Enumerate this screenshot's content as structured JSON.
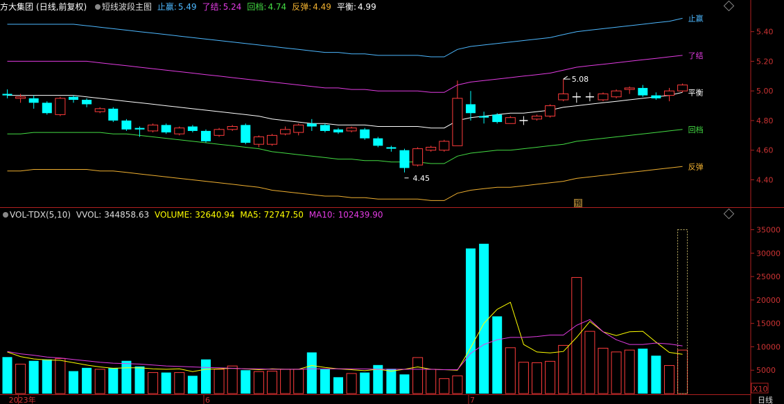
{
  "header": {
    "stock": "方大集团",
    "period": "(日线,前复权)",
    "indicator_icon": "circle-dot-icon",
    "indicator_name": "短线波段主图",
    "items": [
      {
        "label": "止赢:",
        "value": "5.49",
        "color": "#4db8ff"
      },
      {
        "label": "了结:",
        "value": "5.24",
        "color": "#e33ce3"
      },
      {
        "label": "回档:",
        "value": "4.74",
        "color": "#44dd44"
      },
      {
        "label": "反弹:",
        "value": "4.49",
        "color": "#f0b030"
      },
      {
        "label": "平衡:",
        "value": "4.99",
        "color": "#ffffff"
      }
    ]
  },
  "vol_header": {
    "name": "VOL-TDX(5,10)",
    "vvol_label": "VVOL:",
    "vvol": "344858.63",
    "volume_label": "VOLUME:",
    "volume": "32640.94",
    "ma5_label": "MA5:",
    "ma5": "72747.50",
    "ma10_label": "MA10:",
    "ma10": "102439.90"
  },
  "colors": {
    "up": "#ff3c3c",
    "down": "#00ffff",
    "zhiying": "#4db8ff",
    "liaojie": "#e33ce3",
    "huidang": "#44dd44",
    "fantan": "#f0b030",
    "pingheng": "#ffffff",
    "ma5": "#ffff00",
    "ma10": "#e33ce3",
    "axis": "#b02020",
    "ytick": "#cc3333"
  },
  "chart_data": [
    {
      "type": "candlestick",
      "y_ticks": [
        "5.40",
        "5.20",
        "5.00",
        "4.80",
        "4.60",
        "4.40"
      ],
      "ylim": [
        4.22,
        5.52
      ],
      "line_labels": {
        "zhiying": "止赢",
        "liaojie": "了结",
        "pingheng": "平衡",
        "huidang": "回档",
        "fantan": "反弹"
      },
      "annotations": {
        "high": "5.08",
        "low": "4.45",
        "marker": "预"
      },
      "candles": [
        [
          4.98,
          4.97,
          5.01,
          4.95
        ],
        [
          4.95,
          4.96,
          4.98,
          4.92
        ],
        [
          4.95,
          4.92,
          4.97,
          4.88
        ],
        [
          4.92,
          4.85,
          4.93,
          4.84
        ],
        [
          4.84,
          4.95,
          4.96,
          4.83
        ],
        [
          4.96,
          4.94,
          4.97,
          4.92
        ],
        [
          4.94,
          4.91,
          4.95,
          4.89
        ],
        [
          4.86,
          4.88,
          4.89,
          4.85
        ],
        [
          4.88,
          4.8,
          4.89,
          4.79
        ],
        [
          4.8,
          4.74,
          4.81,
          4.73
        ],
        [
          4.75,
          4.74,
          4.76,
          4.69
        ],
        [
          4.73,
          4.77,
          4.78,
          4.72
        ],
        [
          4.77,
          4.72,
          4.78,
          4.71
        ],
        [
          4.71,
          4.75,
          4.76,
          4.7
        ],
        [
          4.76,
          4.73,
          4.77,
          4.72
        ],
        [
          4.73,
          4.66,
          4.74,
          4.65
        ],
        [
          4.7,
          4.74,
          4.75,
          4.69
        ],
        [
          4.74,
          4.76,
          4.77,
          4.73
        ],
        [
          4.77,
          4.65,
          4.78,
          4.64
        ],
        [
          4.64,
          4.69,
          4.7,
          4.62
        ],
        [
          4.64,
          4.7,
          4.71,
          4.63
        ],
        [
          4.71,
          4.74,
          4.76,
          4.7
        ],
        [
          4.72,
          4.77,
          4.78,
          4.7
        ],
        [
          4.78,
          4.76,
          4.81,
          4.73
        ],
        [
          4.77,
          4.73,
          4.78,
          4.72
        ],
        [
          4.74,
          4.72,
          4.75,
          4.71
        ],
        [
          4.73,
          4.75,
          4.76,
          4.72
        ],
        [
          4.74,
          4.68,
          4.75,
          4.67
        ],
        [
          4.68,
          4.63,
          4.69,
          4.62
        ],
        [
          4.62,
          4.61,
          4.63,
          4.59
        ],
        [
          4.6,
          4.48,
          4.61,
          4.45
        ],
        [
          4.5,
          4.61,
          4.62,
          4.49
        ],
        [
          4.6,
          4.62,
          4.63,
          4.59
        ],
        [
          4.6,
          4.66,
          4.67,
          4.59
        ],
        [
          4.63,
          4.95,
          5.07,
          4.63
        ],
        [
          4.91,
          4.85,
          5.0,
          4.8
        ],
        [
          4.83,
          4.82,
          4.86,
          4.78
        ],
        [
          4.84,
          4.79,
          4.85,
          4.78
        ],
        [
          4.78,
          4.82,
          4.83,
          4.78
        ],
        [
          4.8,
          4.8,
          4.83,
          4.77
        ],
        [
          4.81,
          4.83,
          4.84,
          4.8
        ],
        [
          4.83,
          4.9,
          4.91,
          4.82
        ],
        [
          4.94,
          4.98,
          5.08,
          4.93
        ],
        [
          4.96,
          4.96,
          4.99,
          4.92
        ],
        [
          4.96,
          4.96,
          4.99,
          4.93
        ],
        [
          4.94,
          4.98,
          4.99,
          4.93
        ],
        [
          4.96,
          5.0,
          5.01,
          4.95
        ],
        [
          5.01,
          5.02,
          5.03,
          4.98
        ],
        [
          5.02,
          4.97,
          5.04,
          4.96
        ],
        [
          4.97,
          4.95,
          4.99,
          4.94
        ],
        [
          4.97,
          5.0,
          5.02,
          4.93
        ],
        [
          5.0,
          5.04,
          5.05,
          4.99
        ]
      ],
      "pingheng": [
        4.97,
        4.97,
        4.97,
        4.97,
        4.97,
        4.97,
        4.96,
        4.95,
        4.94,
        4.93,
        4.92,
        4.91,
        4.9,
        4.89,
        4.88,
        4.87,
        4.86,
        4.85,
        4.84,
        4.83,
        4.81,
        4.8,
        4.79,
        4.78,
        4.78,
        4.77,
        4.77,
        4.77,
        4.76,
        4.76,
        4.76,
        4.76,
        4.75,
        4.75,
        4.8,
        4.82,
        4.83,
        4.84,
        4.85,
        4.85,
        4.86,
        4.87,
        4.89,
        4.9,
        4.91,
        4.92,
        4.93,
        4.94,
        4.95,
        4.96,
        4.97,
        4.99
      ],
      "zhiying": [
        5.45,
        5.45,
        5.45,
        5.45,
        5.45,
        5.45,
        5.44,
        5.43,
        5.42,
        5.41,
        5.4,
        5.39,
        5.38,
        5.37,
        5.36,
        5.35,
        5.34,
        5.33,
        5.32,
        5.31,
        5.3,
        5.29,
        5.28,
        5.27,
        5.26,
        5.26,
        5.25,
        5.25,
        5.24,
        5.24,
        5.24,
        5.24,
        5.23,
        5.23,
        5.28,
        5.3,
        5.31,
        5.32,
        5.33,
        5.34,
        5.35,
        5.36,
        5.38,
        5.4,
        5.41,
        5.42,
        5.43,
        5.44,
        5.45,
        5.46,
        5.47,
        5.49
      ],
      "liaojie": [
        5.2,
        5.2,
        5.2,
        5.2,
        5.2,
        5.2,
        5.2,
        5.19,
        5.18,
        5.17,
        5.16,
        5.15,
        5.14,
        5.13,
        5.12,
        5.11,
        5.1,
        5.09,
        5.08,
        5.07,
        5.06,
        5.05,
        5.04,
        5.03,
        5.02,
        5.02,
        5.01,
        5.01,
        5.0,
        5.0,
        5.0,
        5.0,
        4.99,
        4.99,
        5.04,
        5.06,
        5.07,
        5.08,
        5.09,
        5.1,
        5.11,
        5.12,
        5.14,
        5.16,
        5.17,
        5.18,
        5.19,
        5.2,
        5.21,
        5.22,
        5.23,
        5.24
      ],
      "huidang": [
        4.71,
        4.71,
        4.72,
        4.72,
        4.72,
        4.72,
        4.72,
        4.72,
        4.71,
        4.71,
        4.7,
        4.69,
        4.68,
        4.67,
        4.66,
        4.65,
        4.64,
        4.63,
        4.62,
        4.61,
        4.59,
        4.58,
        4.57,
        4.56,
        4.55,
        4.54,
        4.54,
        4.53,
        4.53,
        4.52,
        4.52,
        4.52,
        4.51,
        4.51,
        4.56,
        4.58,
        4.59,
        4.6,
        4.6,
        4.61,
        4.62,
        4.63,
        4.64,
        4.66,
        4.67,
        4.68,
        4.69,
        4.7,
        4.71,
        4.72,
        4.73,
        4.74
      ],
      "fantan": [
        4.46,
        4.46,
        4.47,
        4.47,
        4.47,
        4.47,
        4.47,
        4.46,
        4.46,
        4.45,
        4.44,
        4.43,
        4.42,
        4.41,
        4.4,
        4.39,
        4.38,
        4.37,
        4.36,
        4.35,
        4.33,
        4.32,
        4.31,
        4.3,
        4.29,
        4.29,
        4.28,
        4.28,
        4.27,
        4.27,
        4.27,
        4.27,
        4.26,
        4.26,
        4.31,
        4.33,
        4.34,
        4.35,
        4.35,
        4.36,
        4.37,
        4.38,
        4.39,
        4.41,
        4.42,
        4.43,
        4.44,
        4.45,
        4.46,
        4.47,
        4.48,
        4.49
      ]
    },
    {
      "type": "bar",
      "y_ticks": [
        "35000",
        "30000",
        "25000",
        "20000",
        "15000",
        "10000",
        "5000"
      ],
      "ylim": [
        0,
        37000
      ],
      "volume": [
        7800,
        6300,
        7000,
        7300,
        7500,
        4800,
        5500,
        5200,
        5500,
        7000,
        5800,
        4500,
        4500,
        4500,
        3800,
        7300,
        5200,
        5900,
        5000,
        4700,
        4800,
        5200,
        5200,
        8800,
        5200,
        3500,
        4300,
        4500,
        6100,
        5300,
        4100,
        7700,
        5200,
        3200,
        3800,
        31000,
        32000,
        16500,
        9800,
        6700,
        6600,
        6900,
        10300,
        24800,
        13300,
        9700,
        8900,
        9300,
        9600,
        8100,
        6000,
        9300
      ],
      "ma5": [
        8900,
        7900,
        7400,
        7200,
        7100,
        6600,
        6100,
        5700,
        5400,
        5500,
        5500,
        5300,
        5200,
        5300,
        4700,
        5200,
        5300,
        5400,
        5300,
        5100,
        5300,
        5200,
        5200,
        6000,
        5600,
        5300,
        5100,
        4900,
        5200,
        4800,
        5200,
        5700,
        5200,
        5100,
        5000,
        9800,
        15000,
        18000,
        19500,
        10500,
        8900,
        8700,
        9000,
        12000,
        15400,
        13200,
        12400,
        13200,
        13300,
        11000,
        8800,
        8400
      ],
      "ma10": [
        9000,
        8500,
        8200,
        7800,
        7600,
        7300,
        7000,
        6700,
        6500,
        6400,
        6300,
        6100,
        5900,
        5800,
        5700,
        5600,
        5500,
        5400,
        5300,
        5300,
        5200,
        5200,
        5200,
        5300,
        5300,
        5300,
        5300,
        5300,
        5200,
        5200,
        5200,
        5200,
        5200,
        5100,
        5100,
        8600,
        10500,
        11500,
        12000,
        12000,
        12200,
        12500,
        12500,
        14600,
        15800,
        13200,
        11500,
        10500,
        10500,
        10800,
        10600,
        10200
      ],
      "forecast": 35000,
      "unit": "X10"
    }
  ],
  "xaxis": [
    {
      "label": "2023年",
      "index": 1
    },
    {
      "label": "6",
      "index": 15
    },
    {
      "label": "7",
      "index": 35
    }
  ],
  "period_button": "日线"
}
